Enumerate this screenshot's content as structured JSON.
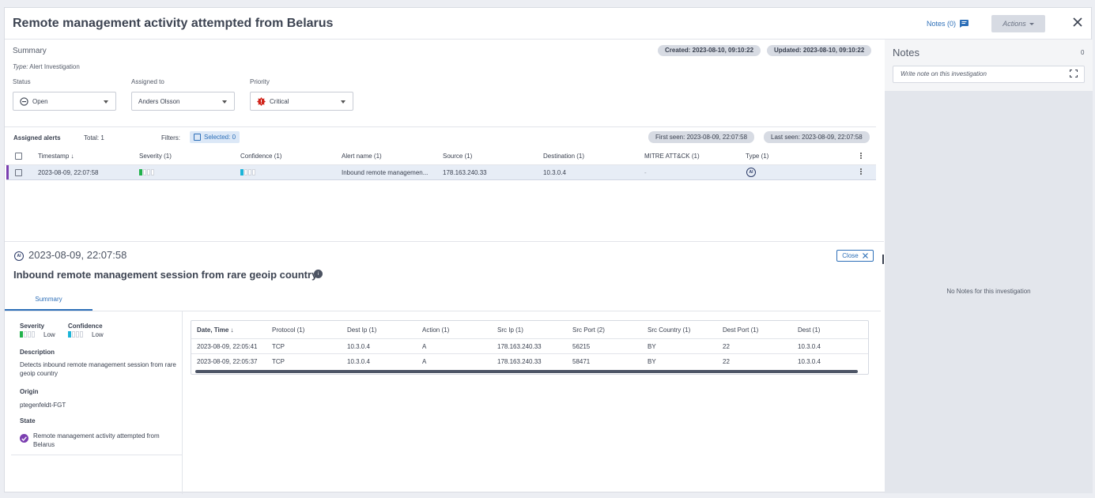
{
  "header": {
    "title": "Remote management activity attempted from Belarus",
    "notes_label": "Notes (0)",
    "actions_label": "Actions"
  },
  "summary": {
    "label": "Summary",
    "type_prefix": "Type:",
    "type_value": "Alert Investigation",
    "created": "Created: 2023-08-10, 09:10:22",
    "updated": "Updated: 2023-08-10, 09:10:22",
    "status_label": "Status",
    "status_value": "Open",
    "assigned_label": "Assigned to",
    "assigned_value": "Anders Olsson",
    "priority_label": "Priority",
    "priority_value": "Critical"
  },
  "alerts": {
    "title": "Assigned alerts",
    "total": "Total: 1",
    "filters": "Filters:",
    "selected": "Selected: 0",
    "first_seen": "First seen: 2023-08-09, 22:07:58",
    "last_seen": "Last seen: 2023-08-09, 22:07:58",
    "columns": [
      "Timestamp",
      "Severity (1)",
      "Confidence (1)",
      "Alert name (1)",
      "Source (1)",
      "Destination (1)",
      "MITRE ATT&CK (1)",
      "Type (1)"
    ],
    "row": {
      "timestamp": "2023-08-09, 22:07:58",
      "severity_level": 1,
      "confidence_level": 1,
      "alert_name": "Inbound remote managemen...",
      "source": "178.163.240.33",
      "destination": "10.3.0.4",
      "mitre": "-",
      "type_badge": "AI"
    }
  },
  "details": {
    "timestamp": "2023-08-09, 22:07:58",
    "badge": "AI",
    "title": "Inbound remote management session from rare geoip country",
    "close_label": "Close",
    "tab": "Summary",
    "severity_label": "Severity",
    "severity_value": "Low",
    "confidence_label": "Confidence",
    "confidence_value": "Low",
    "description_label": "Description",
    "description_value": "Detects inbound remote management session from rare geoip country",
    "origin_label": "Origin",
    "origin_value": "ptegenfeldt-FGT",
    "state_label": "State",
    "state_value": "Remote management activity attempted from Belarus"
  },
  "events": {
    "columns": [
      "Date, Time",
      "Protocol (1)",
      "Dest Ip (1)",
      "Action (1)",
      "Src Ip (1)",
      "Src Port (2)",
      "Src Country (1)",
      "Dest Port (1)",
      "Dest (1)"
    ],
    "rows": [
      [
        "2023-08-09, 22:05:41",
        "TCP",
        "10.3.0.4",
        "A",
        "178.163.240.33",
        "56215",
        "BY",
        "22",
        "10.3.0.4"
      ],
      [
        "2023-08-09, 22:05:37",
        "TCP",
        "10.3.0.4",
        "A",
        "178.163.240.33",
        "58471",
        "BY",
        "22",
        "10.3.0.4"
      ]
    ]
  },
  "notes": {
    "title": "Notes",
    "count": "0",
    "placeholder": "Write note on this investigation",
    "empty": "No Notes for this investigation"
  },
  "colors": {
    "accent": "#2d6fb8",
    "critical": "#d0241b",
    "severity_low": "#22b24c",
    "confidence_low": "#1bb4d8",
    "state_purple": "#7b3fb0"
  }
}
